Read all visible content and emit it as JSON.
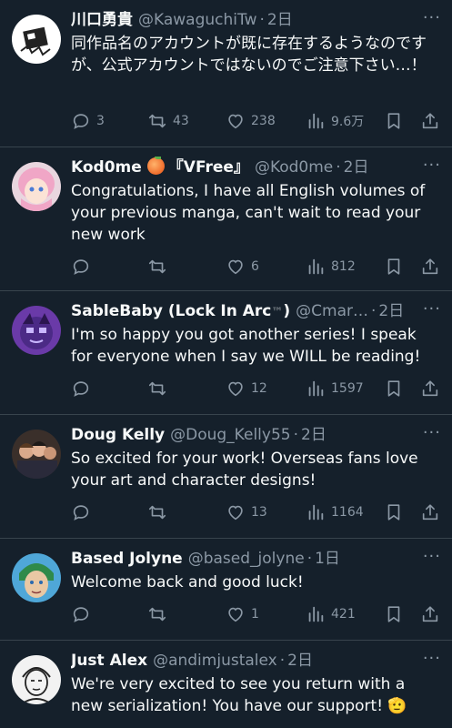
{
  "tweets": [
    {
      "name": "川口勇貴",
      "handle": "@KawaguchiTw",
      "time": "2日",
      "text": "同作品名のアカウントが既に存在するようなのですが、公式アカウントではないのでご注意下さい…！",
      "replies": "3",
      "retweets": "43",
      "likes": "238",
      "views": "9.6万"
    },
    {
      "name": "Kod0me",
      "name_suffix": "『VFree』",
      "handle": "@Kod0me",
      "time": "2日",
      "text": "Congratulations, I have all English volumes of your previous manga, can't wait to read your new work",
      "replies": "",
      "retweets": "",
      "likes": "6",
      "views": "812"
    },
    {
      "name": "SableBaby (Lock In Arc",
      "name_tm": "™",
      "name_close": ")",
      "handle": "@Cmar…",
      "time": "2日",
      "text": "I'm so happy you got another series! I speak for everyone when I say we WILL be reading!",
      "replies": "",
      "retweets": "",
      "likes": "12",
      "views": "1597"
    },
    {
      "name": "Doug Kelly",
      "handle": "@Doug_Kelly55",
      "time": "2日",
      "text": "So excited for your work! Overseas fans love your art and character designs!",
      "replies": "",
      "retweets": "",
      "likes": "13",
      "views": "1164"
    },
    {
      "name": "Based Jolyne",
      "handle": "@based_jolyne",
      "time": "1日",
      "text": "Welcome back and good luck!",
      "replies": "",
      "retweets": "",
      "likes": "1",
      "views": "421"
    },
    {
      "name": "Just Alex",
      "handle": "@andimjustalex",
      "time": "2日",
      "text": "We're very excited to see you return with a new serialization! You have our support! 🫡",
      "replies": "",
      "retweets": "",
      "likes": "",
      "views": ""
    }
  ],
  "dot": "·",
  "more_label": "···",
  "colors": {
    "background": "#15202b",
    "text": "#f7f9f9",
    "muted": "#8b98a5",
    "divider": "#38444d"
  },
  "icons": [
    "reply-icon",
    "retweet-icon",
    "like-icon",
    "views-icon",
    "bookmark-icon",
    "share-icon"
  ]
}
